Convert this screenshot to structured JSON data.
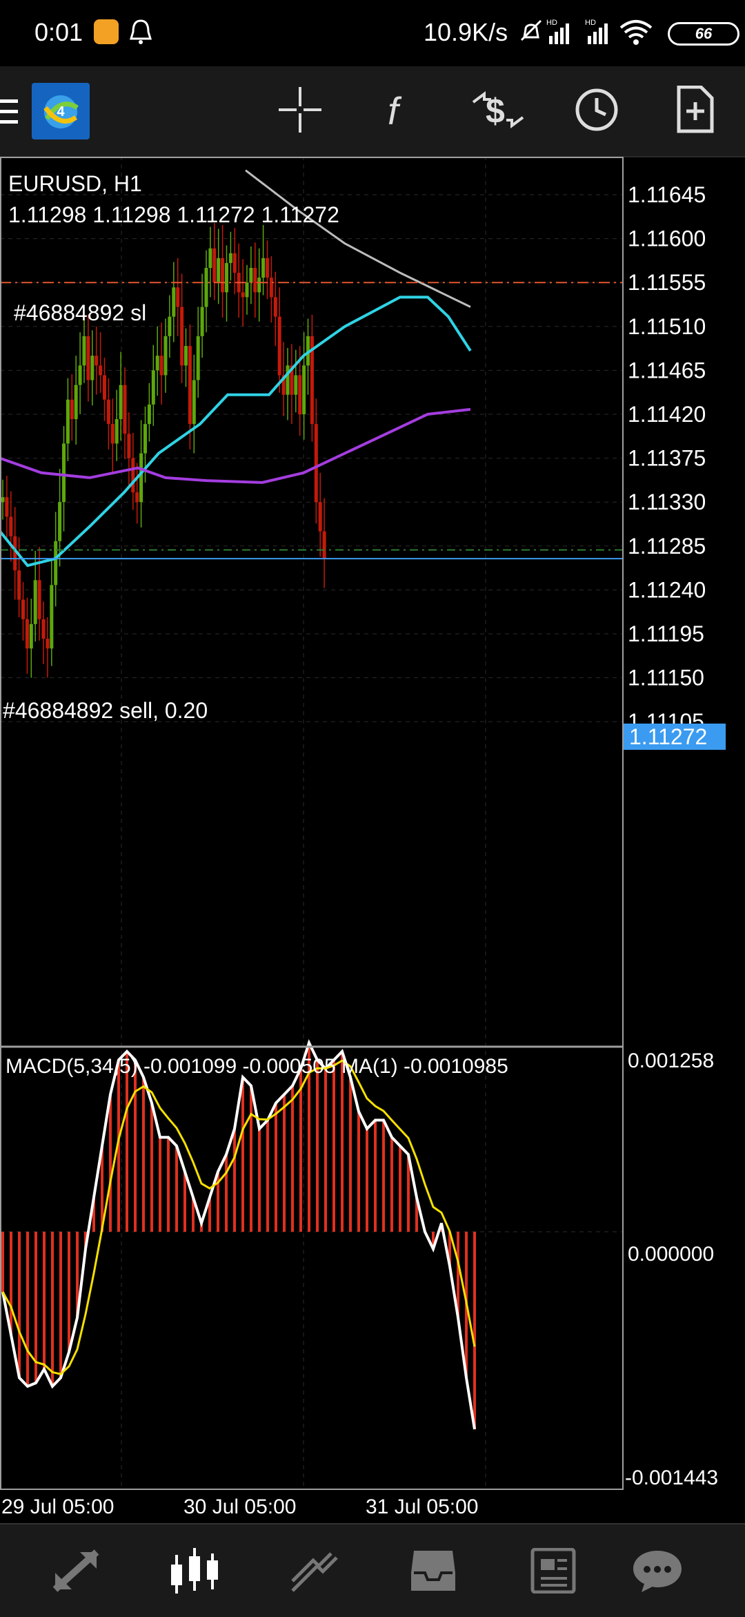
{
  "status_bar": {
    "time": "0:01",
    "net_speed": "10.9K/s",
    "battery": "66"
  },
  "toolbar": {
    "icons": [
      "menu-icon",
      "mt4-logo-icon",
      "crosshair-icon",
      "indicator-f-icon",
      "trade-dollar-icon",
      "clock-icon",
      "new-order-icon"
    ]
  },
  "chart": {
    "symbol_label": "EURUSD, H1",
    "ohlc_label": "1.11298 1.11298 1.11272 1.11272",
    "sl_label": "#46884892 sl",
    "order_label": "#46884892 sell, 0.20",
    "current_price": "1.11272",
    "price_ticks": [
      "1.11645",
      "1.11600",
      "1.11555",
      "1.11510",
      "1.11465",
      "1.11420",
      "1.11375",
      "1.11330",
      "1.11285",
      "1.11240",
      "1.11195",
      "1.11150",
      "1.11105"
    ],
    "macd_label": "MACD(5,34,5) -0.001099 -0.000505 MA(1) -0.0010985",
    "macd_ticks": [
      "0.001258",
      "0.000000",
      "-0.001443"
    ],
    "time_labels": [
      "29 Jul 05:00",
      "30 Jul 05:00",
      "31 Jul 05:00"
    ],
    "colors": {
      "bull": "#5ea70c",
      "bear": "#c41a0a",
      "ma_fast": "#2fd3e5",
      "ma_slow": "#a43de0",
      "trend": "#bdbdbd",
      "sl_line": "#e4572e",
      "price_line": "#3b9bf0",
      "macd_hist": "#e0301e",
      "macd_main": "#ffffff",
      "macd_signal": "#f5e000"
    }
  },
  "bottom_nav": {
    "items": [
      "quotes-arrows-icon",
      "chart-candles-icon",
      "trade-icon",
      "history-inbox-icon",
      "news-icon",
      "chat-icon"
    ]
  }
}
